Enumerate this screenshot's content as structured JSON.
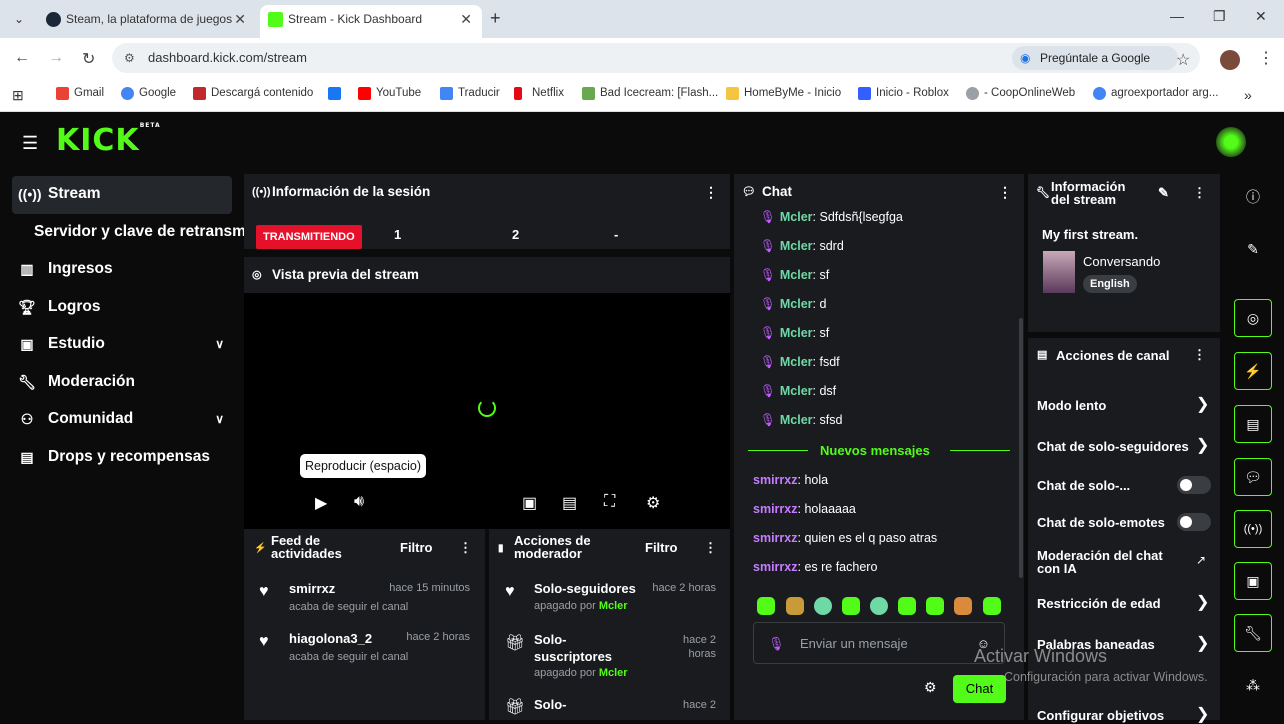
{
  "browser": {
    "tabs": [
      {
        "title": "Steam, la plataforma de juegos",
        "active": false
      },
      {
        "title": "Stream - Kick Dashboard",
        "active": true
      }
    ],
    "url": "dashboard.kick.com/stream",
    "ask_google": "Pregúntale a Google",
    "bookmarks": [
      "Gmail",
      "Google",
      "Descargá contenido",
      "YouTube",
      "Traducir",
      "Netflix",
      "Bad Icecream: [Flash...",
      "HomeByMe - Inicio",
      "Inicio - Roblox",
      "- CoopOnlineWeb",
      "agroexportador arg..."
    ]
  },
  "app": {
    "logo": "KICK",
    "logo_badge": "BETA",
    "sidebar": [
      {
        "label": "Stream",
        "icon": "broadcast-icon",
        "selected": true
      },
      {
        "label": "Servidor y clave de retransm",
        "icon": "",
        "sub": true
      },
      {
        "label": "Ingresos",
        "icon": "chart-icon"
      },
      {
        "label": "Logros",
        "icon": "trophy-icon"
      },
      {
        "label": "Estudio",
        "icon": "studio-icon",
        "expandable": true
      },
      {
        "label": "Moderación",
        "icon": "wrench-icon"
      },
      {
        "label": "Comunidad",
        "icon": "people-icon",
        "expandable": true
      },
      {
        "label": "Drops y recompensas",
        "icon": "gift-icon"
      }
    ],
    "session": {
      "title": "Información de la sesión",
      "status": "TRANSMITIENDO",
      "stats": [
        "1",
        "2",
        "-"
      ]
    },
    "preview": {
      "title": "Vista previa del stream",
      "tooltip": "Reproducir (espacio)"
    },
    "activity": {
      "title_line1": "Feed de",
      "title_line2": "actividades",
      "filter": "Filtro",
      "items": [
        {
          "name": "smirrxz",
          "time": "hace 15 minutos",
          "sub": "acaba de seguir el canal"
        },
        {
          "name": "hiagolona3_2",
          "time": "hace 2 horas",
          "sub": "acaba de seguir el canal"
        }
      ]
    },
    "modactions": {
      "title_line1": "Acciones de",
      "title_line2": "moderador",
      "filter": "Filtro",
      "items": [
        {
          "name": "Solo-seguidores",
          "time": "hace 2 horas",
          "sub_prefix": "apagado por",
          "by": "Mcler"
        },
        {
          "name_line1": "Solo-",
          "name_line2": "suscriptores",
          "time_line1": "hace 2",
          "time_line2": "horas",
          "sub_prefix": "apagado por",
          "by": "Mcler"
        },
        {
          "name": "Solo-",
          "time": "hace 2"
        }
      ]
    },
    "chat": {
      "title": "Chat",
      "old_messages": [
        {
          "user": "Mcler",
          "text": "Sdfdsñ{lsegfga"
        },
        {
          "user": "Mcler",
          "text": "sdrd"
        },
        {
          "user": "Mcler",
          "text": "sf"
        },
        {
          "user": "Mcler",
          "text": "d"
        },
        {
          "user": "Mcler",
          "text": "sf"
        },
        {
          "user": "Mcler",
          "text": "fsdf"
        },
        {
          "user": "Mcler",
          "text": "dsf"
        },
        {
          "user": "Mcler",
          "text": "sfsd"
        }
      ],
      "new_label": "Nuevos mensajes",
      "new_messages": [
        {
          "user": "smirrxz",
          "text": "hola"
        },
        {
          "user": "smirrxz",
          "text": "holaaaaa"
        },
        {
          "user": "smirrxz",
          "text": "quien es el q paso atras"
        },
        {
          "user": "smirrxz",
          "text": "es re fachero"
        }
      ],
      "placeholder": "Enviar un mensaje",
      "send": "Chat"
    },
    "stream_info": {
      "title_line1": "Información",
      "title_line2": "del stream",
      "stream_title": "My first stream.",
      "category": "Conversando",
      "language": "English"
    },
    "channel_actions": {
      "title": "Acciones de canal",
      "items": [
        {
          "label": "Modo lento",
          "control": "chevron"
        },
        {
          "label": "Chat de solo-seguidores",
          "control": "chevron"
        },
        {
          "label": "Chat de solo-...",
          "control": "toggle"
        },
        {
          "label": "Chat de solo-emotes",
          "control": "toggle"
        },
        {
          "label_line1": "Moderación del chat",
          "label_line2": "con IA",
          "control": "external"
        },
        {
          "label": "Restricción de edad",
          "control": "chevron"
        },
        {
          "label": "Palabras baneadas",
          "control": "chevron"
        },
        {
          "label": "Configurar objetivos",
          "control": "chevron"
        }
      ]
    },
    "watermark": {
      "line1": "Activar Windows",
      "line2": "Configuración para activar Windows."
    }
  }
}
